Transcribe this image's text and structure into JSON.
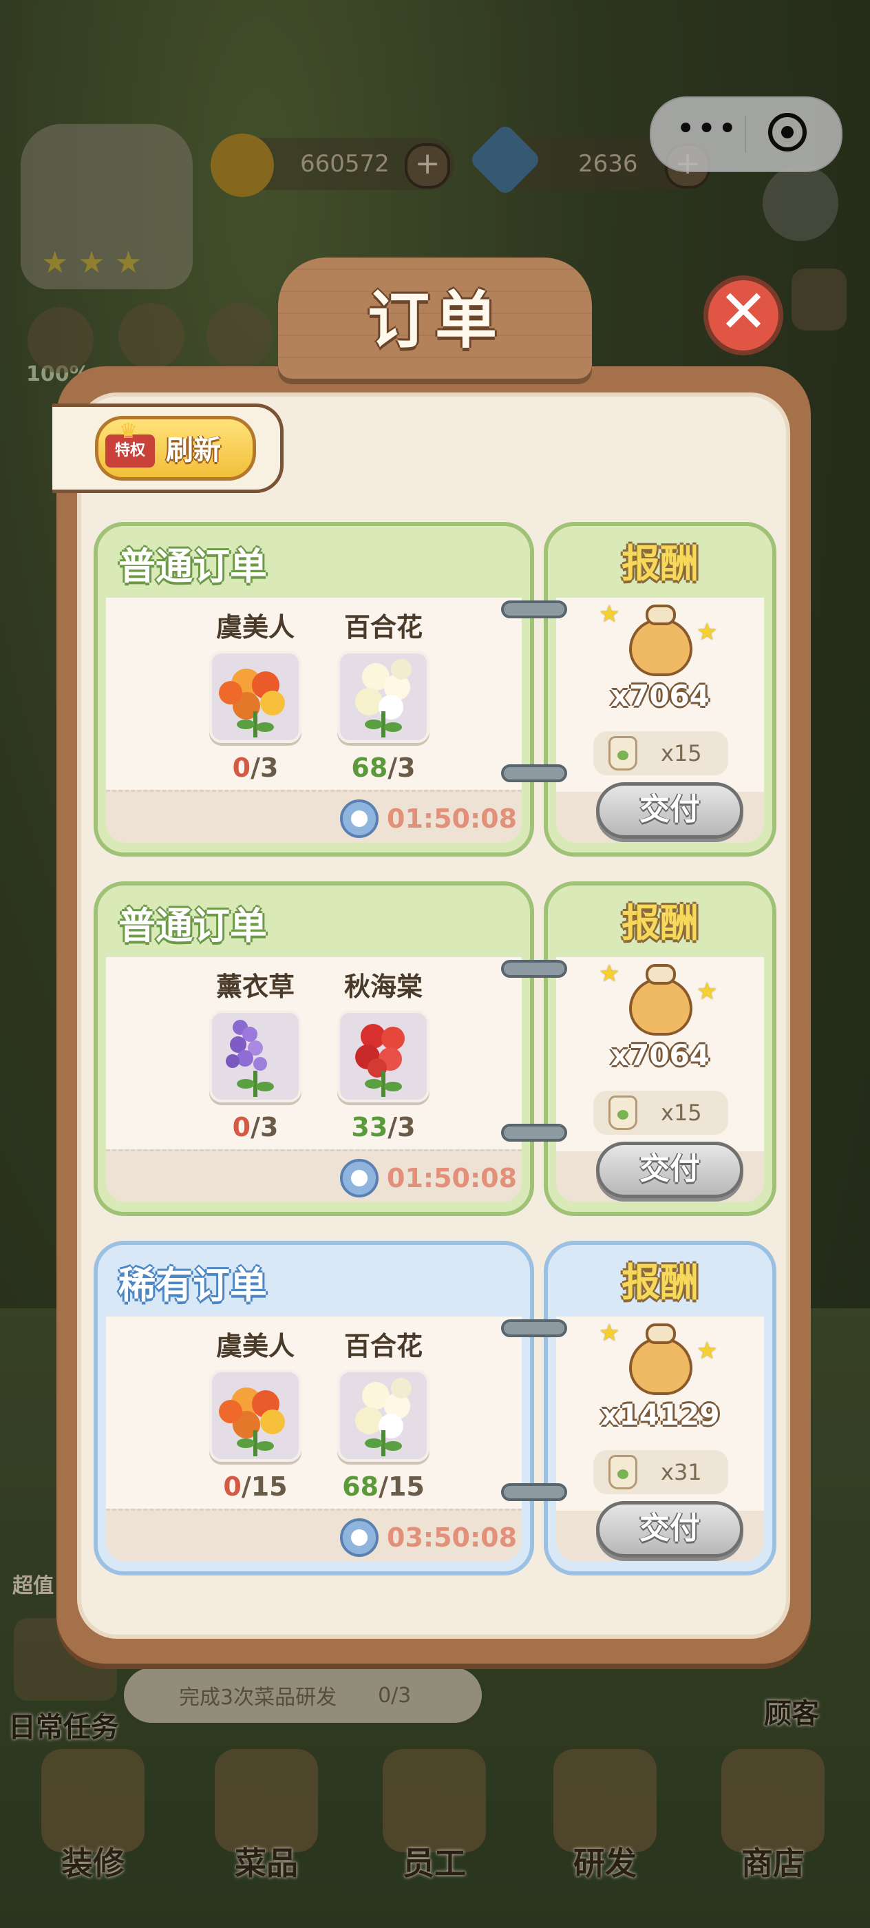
{
  "hud": {
    "coins": "660572",
    "gems": "2636",
    "hud_left_pct": "100%"
  },
  "modal": {
    "title": "订单",
    "refresh_label": "刷新",
    "vip_badge": "特权"
  },
  "orders": [
    {
      "type": "普通订单",
      "theme": "green",
      "items": [
        {
          "name": "虞美人",
          "have": "0",
          "need": "/3",
          "have_color": "red",
          "flower": "poppy"
        },
        {
          "name": "百合花",
          "have": "68",
          "need": "/3",
          "have_color": "green",
          "flower": "lily"
        }
      ],
      "timer": "01:50:08",
      "reward_title": "报酬",
      "reward_amount": "x7064",
      "jar_qty": "x15",
      "deliver_label": "交付"
    },
    {
      "type": "普通订单",
      "theme": "green",
      "items": [
        {
          "name": "薰衣草",
          "have": "0",
          "need": "/3",
          "have_color": "red",
          "flower": "lavender"
        },
        {
          "name": "秋海棠",
          "have": "33",
          "need": "/3",
          "have_color": "green",
          "flower": "begonia"
        }
      ],
      "timer": "01:50:08",
      "reward_title": "报酬",
      "reward_amount": "x7064",
      "jar_qty": "x15",
      "deliver_label": "交付"
    },
    {
      "type": "稀有订单",
      "theme": "blue",
      "items": [
        {
          "name": "虞美人",
          "have": "0",
          "need": "/15",
          "have_color": "red",
          "flower": "poppy"
        },
        {
          "name": "百合花",
          "have": "68",
          "need": "/15",
          "have_color": "green",
          "flower": "lily"
        }
      ],
      "timer": "03:50:08",
      "reward_title": "报酬",
      "reward_amount": "x14129",
      "jar_qty": "x31",
      "deliver_label": "交付"
    }
  ],
  "task_bar": {
    "text": "完成3次菜品研发",
    "progress": "0/3"
  },
  "left_side": {
    "daily_tasks": "日常任务",
    "cheap": "超值"
  },
  "right_side": {
    "customers": "顾客"
  },
  "bottom_nav": [
    {
      "label": "装修",
      "icon": "paint-bucket-icon"
    },
    {
      "label": "菜品",
      "icon": "fork-spoon-icon"
    },
    {
      "label": "员工",
      "icon": "mug-icon"
    },
    {
      "label": "研发",
      "icon": "pot-icon"
    },
    {
      "label": "商店",
      "icon": "shop-icon"
    }
  ],
  "colors": {
    "modal_frame": "#a5714a",
    "green_card": "#d9e9b8",
    "blue_card": "#d9e8f6",
    "close_red": "#e15545",
    "have_red": "#d45a44",
    "have_green": "#5b9a3a",
    "timer_text": "#e2907a"
  }
}
